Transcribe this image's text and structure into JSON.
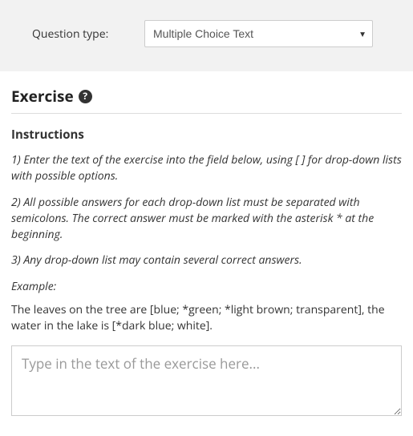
{
  "question_type": {
    "label": "Question type:",
    "selected": "Multiple Choice Text"
  },
  "exercise": {
    "heading": "Exercise",
    "help_glyph": "?",
    "instructions_heading": "Instructions",
    "instructions": [
      "1) Enter the text of the exercise into the field below, using [ ] for drop-down lists with possible options.",
      "2) All possible answers for each drop-down list must be separated with semicolons. The correct answer must be marked with the asterisk * at the beginning.",
      "3) Any drop-down list may contain several correct answers."
    ],
    "example_label": "Example:",
    "example_text": "The leaves on the tree are [blue; *green; *light brown; transparent], the water in the lake is [*dark blue; white].",
    "textarea_placeholder": "Type in the text of the exercise here..."
  }
}
